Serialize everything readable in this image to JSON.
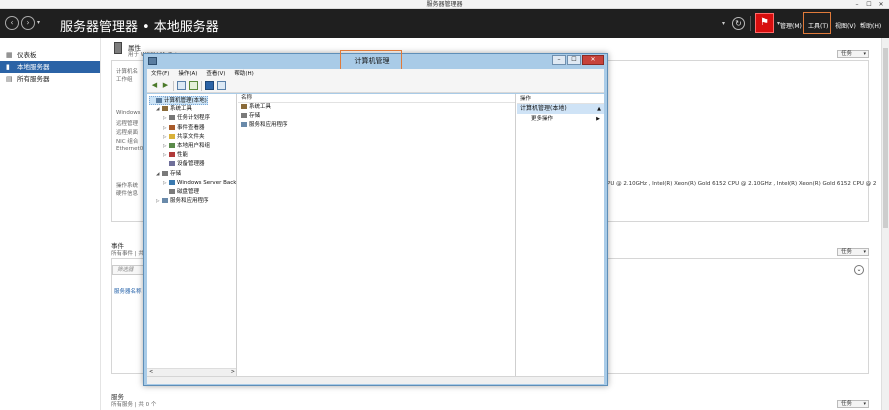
{
  "window": {
    "title": "服务器管理器",
    "controls": [
      "–",
      "☐",
      "✕"
    ]
  },
  "header": {
    "breadcrumb": [
      "服务器管理器",
      "本地服务器"
    ],
    "breadcrumb_sep": "•",
    "menus": {
      "manage": "管理(M)",
      "tools": "工具(T)",
      "view": "视图(V)",
      "help": "帮助(H)"
    }
  },
  "sidebar": {
    "items": [
      {
        "label": "仪表板",
        "icon": "dashboard-icon"
      },
      {
        "label": "本地服务器",
        "icon": "server-icon",
        "active": true
      },
      {
        "label": "所有服务器",
        "icon": "servers-icon"
      }
    ]
  },
  "background": {
    "properties_title": "属性",
    "properties_sub": "用于 WCCH-MaZxi",
    "computer_name_label": "计算机名",
    "workgroup_label": "工作组",
    "windows_label": "Windows",
    "remote_mgmt_label": "远程管理",
    "remote_desktop_label": "远程桌面",
    "nic_label": "NIC 组合",
    "ethernet_label": "Ethernet0",
    "os_label": "操作系统",
    "hardware_label": "硬件信息",
    "cpu_text": "PU @ 2.10GHz , Intel(R) Xeon(R) Gold 6152 CPU @ 2.10GHz , Intel(R) Xeon(R) Gold 6152 CPU @ 2",
    "tasks_label": "任务",
    "events_title": "事件",
    "events_sub": "所有事件 | 共",
    "filter_placeholder": "筛选器",
    "server_name_col": "服务器名称",
    "services_title": "服务",
    "services_sub": "所有服务 | 共 0 个"
  },
  "cm": {
    "title": "计算机管理",
    "menus": [
      "文件(F)",
      "操作(A)",
      "查看(V)",
      "帮助(H)"
    ],
    "tree": [
      {
        "label": "计算机管理(本地)",
        "level": 0,
        "twisty": "",
        "selected": true,
        "color": "#5a7da0"
      },
      {
        "label": "系统工具",
        "level": 1,
        "twisty": "◢",
        "color": "#8a6b3a"
      },
      {
        "label": "任务计划程序",
        "level": 2,
        "twisty": "▷",
        "color": "#777777"
      },
      {
        "label": "事件查看器",
        "level": 2,
        "twisty": "▷",
        "color": "#a85a2a"
      },
      {
        "label": "共享文件夹",
        "level": 2,
        "twisty": "▷",
        "color": "#d9b23a"
      },
      {
        "label": "本地用户和组",
        "level": 2,
        "twisty": "▷",
        "color": "#5a8a4a"
      },
      {
        "label": "性能",
        "level": 2,
        "twisty": "▷",
        "color": "#b03a3a"
      },
      {
        "label": "设备管理器",
        "level": 2,
        "twisty": "",
        "color": "#6f6f9a"
      },
      {
        "label": "存储",
        "level": 1,
        "twisty": "◢",
        "color": "#7a7a7a"
      },
      {
        "label": "Windows Server Back",
        "level": 2,
        "twisty": "▷",
        "color": "#3a7ab0"
      },
      {
        "label": "磁盘管理",
        "level": 2,
        "twisty": "",
        "color": "#7a7a7a"
      },
      {
        "label": "服务和应用程序",
        "level": 1,
        "twisty": "▷",
        "color": "#6a8aaa"
      }
    ],
    "center_header": "名称",
    "center_items": [
      {
        "label": "系统工具",
        "color": "#8a6b3a"
      },
      {
        "label": "存储",
        "color": "#7a7a7a"
      },
      {
        "label": "服务和应用程序",
        "color": "#6a8aaa"
      }
    ],
    "actions_header": "操作",
    "actions_section": "计算机管理(本地)",
    "actions_more": "更多操作"
  }
}
